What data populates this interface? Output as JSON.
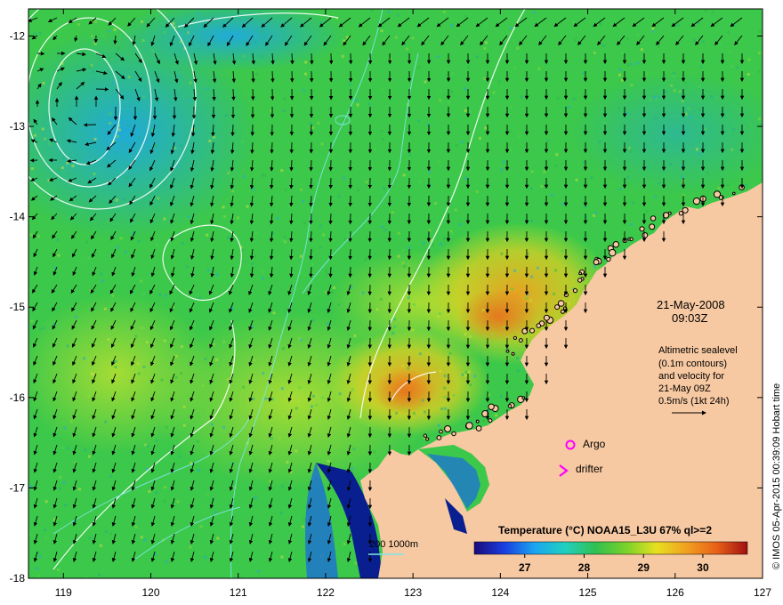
{
  "map": {
    "lon_range": [
      118.6,
      127.0
    ],
    "lat_range": [
      -18.0,
      -11.7
    ],
    "lon_ticks": [
      "119",
      "120",
      "121",
      "122",
      "123",
      "124",
      "125",
      "126",
      "127"
    ],
    "lat_ticks": [
      "-12",
      "-13",
      "-14",
      "-15",
      "-16",
      "-17",
      "-18"
    ],
    "colors": {
      "sea_base": "#3cc84a",
      "land": "#f7c9a2",
      "coast_deep": "#0a1f8f",
      "warm_patch": "#f0a020",
      "hot_patch": "#e8701c",
      "contour_white": "#ffffff",
      "contour_cyan": "#7fe5e8",
      "argo_marker": "#ff00ff",
      "drifter_marker": "#ff00ff"
    }
  },
  "annotations": {
    "date": "21-May-2008",
    "time": "09:03Z",
    "altimetry_line1": "Altimetric sealevel",
    "altimetry_line2": "(0.1m contours)",
    "altimetry_line3": "and velocity for",
    "altimetry_line4": "21-May 09Z",
    "velocity_scale": "0.5m/s (1kt 24h)",
    "argo_label": "Argo",
    "drifter_label": "drifter",
    "bathymetry_label": "200  1000m"
  },
  "colorbar": {
    "title": "Temperature (°C) NOAA15_L3U 67% ql>=2",
    "ticks": [
      "27",
      "28",
      "29",
      "30"
    ],
    "tick_values": [
      27,
      28,
      29,
      30
    ],
    "range": [
      26.15,
      30.75
    ],
    "stops": [
      "#1a0a7a",
      "#1a3fe0",
      "#1aa6f0",
      "#20d0c0",
      "#30c050",
      "#7ad22a",
      "#e8e020",
      "#f0a020",
      "#e86018",
      "#a01010"
    ]
  },
  "credit": "© IMOS 05-Apr-2015 00:39:09 Hobart time"
}
